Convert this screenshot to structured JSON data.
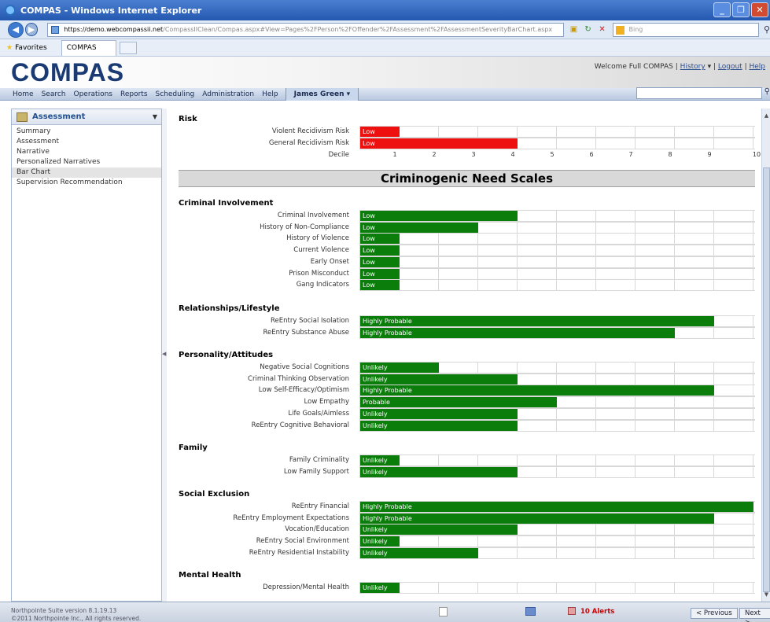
{
  "window": {
    "title": "COMPAS - Windows Internet Explorer"
  },
  "browser": {
    "url_prefix": "https://demo.",
    "url_domain": "webcompassii.net",
    "url_rest": "/CompassIIClean/Compas.aspx#View=Pages%2FPerson%2FOffender%2FAssessment%2FAssessmentSeverityBarChart.aspx",
    "search_placeholder": "Bing",
    "favorites_label": "Favorites",
    "tab_label": "COMPAS"
  },
  "app": {
    "logo": "COMPAS",
    "welcome": "Welcome Full COMPAS",
    "history": "History",
    "logout": "Logout",
    "help": "Help"
  },
  "menu": [
    "Home",
    "Search",
    "Operations",
    "Reports",
    "Scheduling",
    "Administration",
    "Help"
  ],
  "menu_active": "James Green",
  "sidebar": {
    "header": "Assessment",
    "items": [
      "Summary",
      "Assessment",
      "Narrative",
      "Personalized Narratives",
      "Bar Chart",
      "Supervision Recommendation"
    ],
    "selected": "Bar Chart"
  },
  "risk": {
    "title": "Risk",
    "decile_label": "Decile",
    "rows": [
      {
        "label": "Violent Recidivism Risk",
        "decile": 1,
        "text": "Low"
      },
      {
        "label": "General Recidivism Risk",
        "decile": 4,
        "text": "Low"
      }
    ]
  },
  "deciles": [
    "1",
    "2",
    "3",
    "4",
    "5",
    "6",
    "7",
    "8",
    "9",
    "10"
  ],
  "banner": "Criminogenic Need Scales",
  "scales": [
    {
      "title": "Criminal Involvement",
      "rows": [
        {
          "label": "Criminal Involvement",
          "decile": 4,
          "text": "Low"
        },
        {
          "label": "History of Non-Compliance",
          "decile": 3,
          "text": "Low"
        },
        {
          "label": "History of Violence",
          "decile": 1,
          "text": "Low"
        },
        {
          "label": "Current Violence",
          "decile": 1,
          "text": "Low"
        },
        {
          "label": "Early Onset",
          "decile": 1,
          "text": "Low"
        },
        {
          "label": "Prison Misconduct",
          "decile": 1,
          "text": "Low"
        },
        {
          "label": "Gang Indicators",
          "decile": 1,
          "text": "Low"
        }
      ]
    },
    {
      "title": "Relationships/Lifestyle",
      "rows": [
        {
          "label": "ReEntry Social Isolation",
          "decile": 9,
          "text": "Highly Probable"
        },
        {
          "label": "ReEntry Substance Abuse",
          "decile": 8,
          "text": "Highly Probable"
        }
      ]
    },
    {
      "title": "Personality/Attitudes",
      "rows": [
        {
          "label": "Negative Social Cognitions",
          "decile": 2,
          "text": "Unlikely"
        },
        {
          "label": "Criminal Thinking Observation",
          "decile": 4,
          "text": "Unlikely"
        },
        {
          "label": "Low Self-Efficacy/Optimism",
          "decile": 9,
          "text": "Highly Probable"
        },
        {
          "label": "Low Empathy",
          "decile": 5,
          "text": "Probable"
        },
        {
          "label": "Life Goals/Aimless",
          "decile": 4,
          "text": "Unlikely"
        },
        {
          "label": "ReEntry Cognitive Behavioral",
          "decile": 4,
          "text": "Unlikely"
        }
      ]
    },
    {
      "title": "Family",
      "rows": [
        {
          "label": "Family Criminality",
          "decile": 1,
          "text": "Unlikely"
        },
        {
          "label": "Low Family Support",
          "decile": 4,
          "text": "Unlikely"
        }
      ]
    },
    {
      "title": "Social Exclusion",
      "rows": [
        {
          "label": "ReEntry Financial",
          "decile": 10,
          "text": "Highly Probable"
        },
        {
          "label": "ReEntry Employment Expectations",
          "decile": 9,
          "text": "Highly Probable"
        },
        {
          "label": "Vocation/Education",
          "decile": 4,
          "text": "Unlikely"
        },
        {
          "label": "ReEntry Social Environment",
          "decile": 1,
          "text": "Unlikely"
        },
        {
          "label": "ReEntry Residential Instability",
          "decile": 3,
          "text": "Unlikely"
        }
      ]
    },
    {
      "title": "Mental Health",
      "rows": [
        {
          "label": "Depression/Mental Health",
          "decile": 1,
          "text": "Unlikely"
        }
      ]
    }
  ],
  "footer": {
    "version": "Northpointe Suite version 8.1.19.13",
    "copyright": "©2011 Northpointe Inc., All rights reserved.",
    "alerts": "10 Alerts",
    "prev": "< Previous",
    "next": "Next >"
  },
  "colors": {
    "risk_bar": "#ee0f0f",
    "need_bar": "#0a7d0a",
    "accent": "#1a3a74"
  }
}
